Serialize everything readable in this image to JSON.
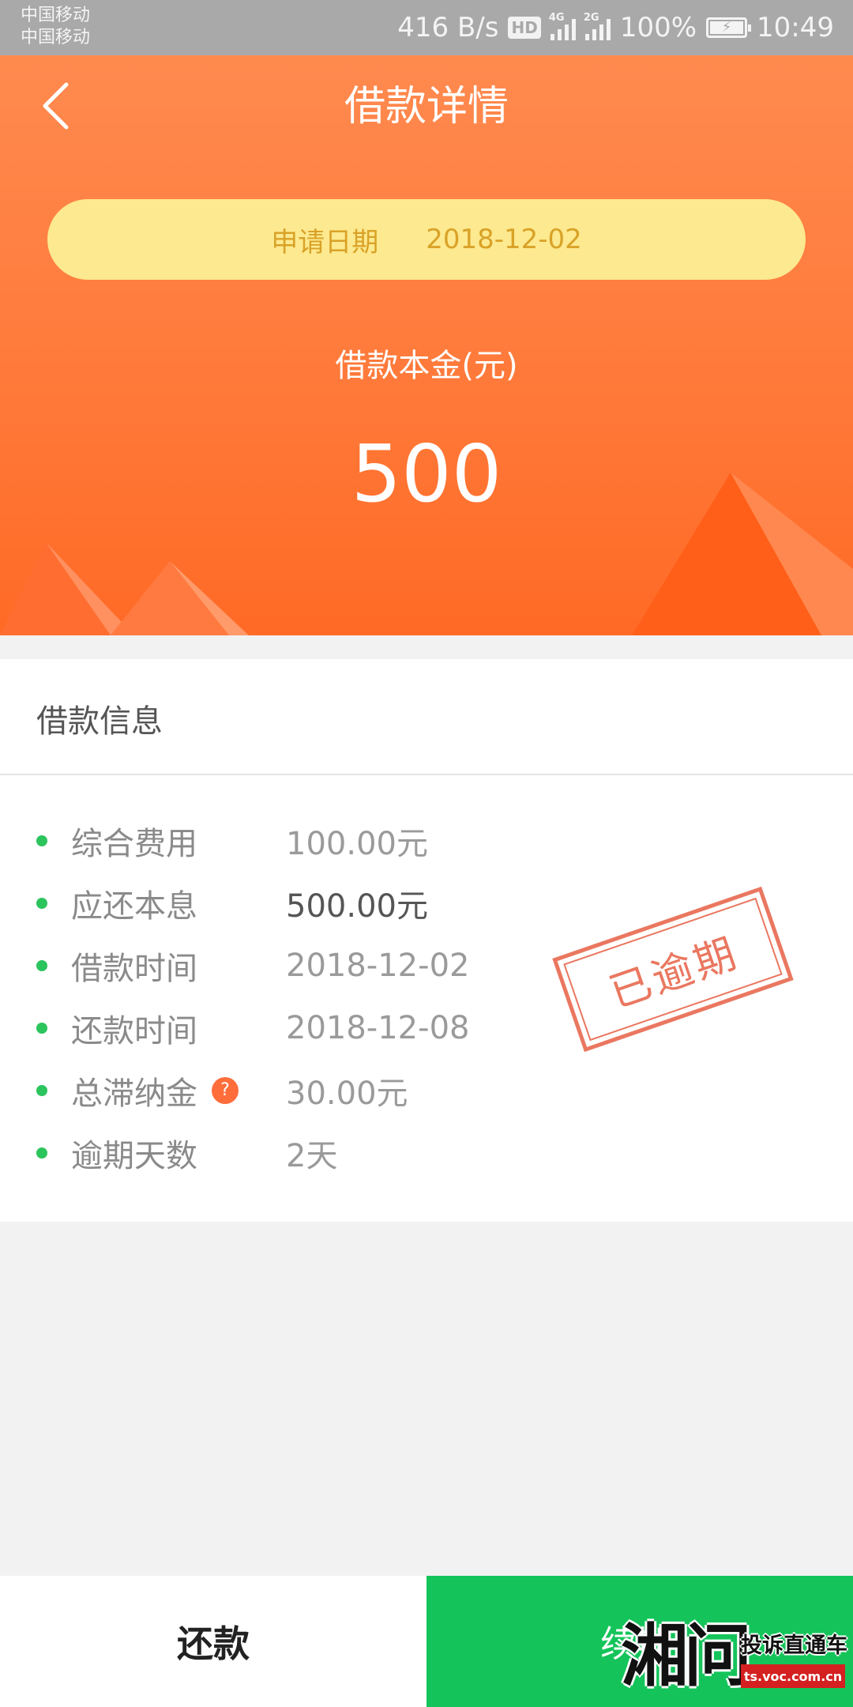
{
  "status_bar": {
    "carrier_1": "中国移动",
    "carrier_2": "中国移动",
    "network_speed": "416 B/s",
    "hd_label": "HD",
    "signal_1_label": "4G",
    "signal_2_label": "2G",
    "battery": "100%",
    "time": "10:49"
  },
  "header": {
    "title": "借款详情",
    "apply_date_label": "申请日期",
    "apply_date": "2018-12-02",
    "principal_label": "借款本金(元)",
    "principal_value": "500"
  },
  "loan_info": {
    "section_title": "借款信息",
    "rows": [
      {
        "label": "综合费用",
        "value": "100.00元"
      },
      {
        "label": "应还本息",
        "value": "500.00元"
      },
      {
        "label": "借款时间",
        "value": "2018-12-02"
      },
      {
        "label": "还款时间",
        "value": "2018-12-08"
      },
      {
        "label": "总滞纳金",
        "value": "30.00元",
        "help": "?"
      },
      {
        "label": "逾期天数",
        "value": "2天"
      }
    ],
    "overdue_stamp": "已逾期"
  },
  "bottom_bar": {
    "repay_label": "还款",
    "renew_label": "续期"
  },
  "watermark": {
    "logo": "湘问",
    "tagline": "投诉直通车",
    "url": "ts.voc.com.cn"
  },
  "colors": {
    "header_orange": "#ff7a3a",
    "date_pill": "#fde98f",
    "accent_green": "#14c45a",
    "stamp_red": "#e8694f"
  },
  "icons": [
    "back-icon",
    "help-icon",
    "battery-icon",
    "signal-icon"
  ]
}
